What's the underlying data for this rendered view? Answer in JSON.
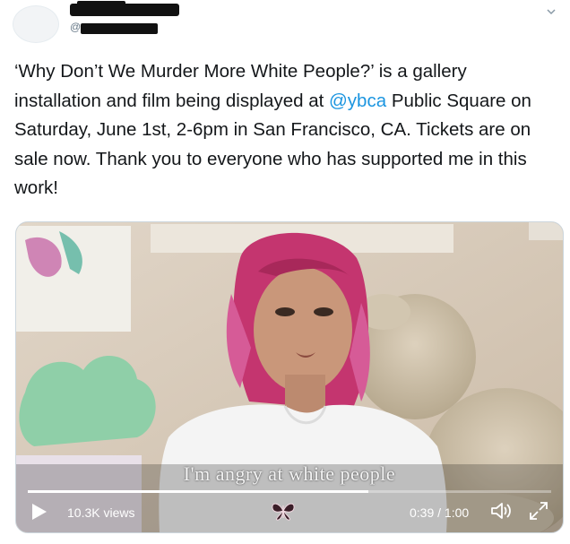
{
  "tweet": {
    "handle_prefix": "@",
    "text_before": "‘Why Don’t We Murder More White People?’ is a gallery installation and film being displayed at ",
    "mention": "@ybca",
    "text_after": " Public Square on Saturday, June 1st, 2-6pm in San Francisco, CA. Tickets are on sale now. Thank you to everyone who has supported me in this work!"
  },
  "video": {
    "subtitle": "I'm angry at white people",
    "views": "10.3K views",
    "time": "0:39 / 1:00",
    "progress": 0.65
  },
  "colors": {
    "mention": "#1b95e0",
    "text": "#14171a",
    "muted": "#657786"
  },
  "icons": [
    "chevron-down-icon",
    "play-icon",
    "butterfly-icon",
    "volume-icon",
    "expand-icon"
  ]
}
